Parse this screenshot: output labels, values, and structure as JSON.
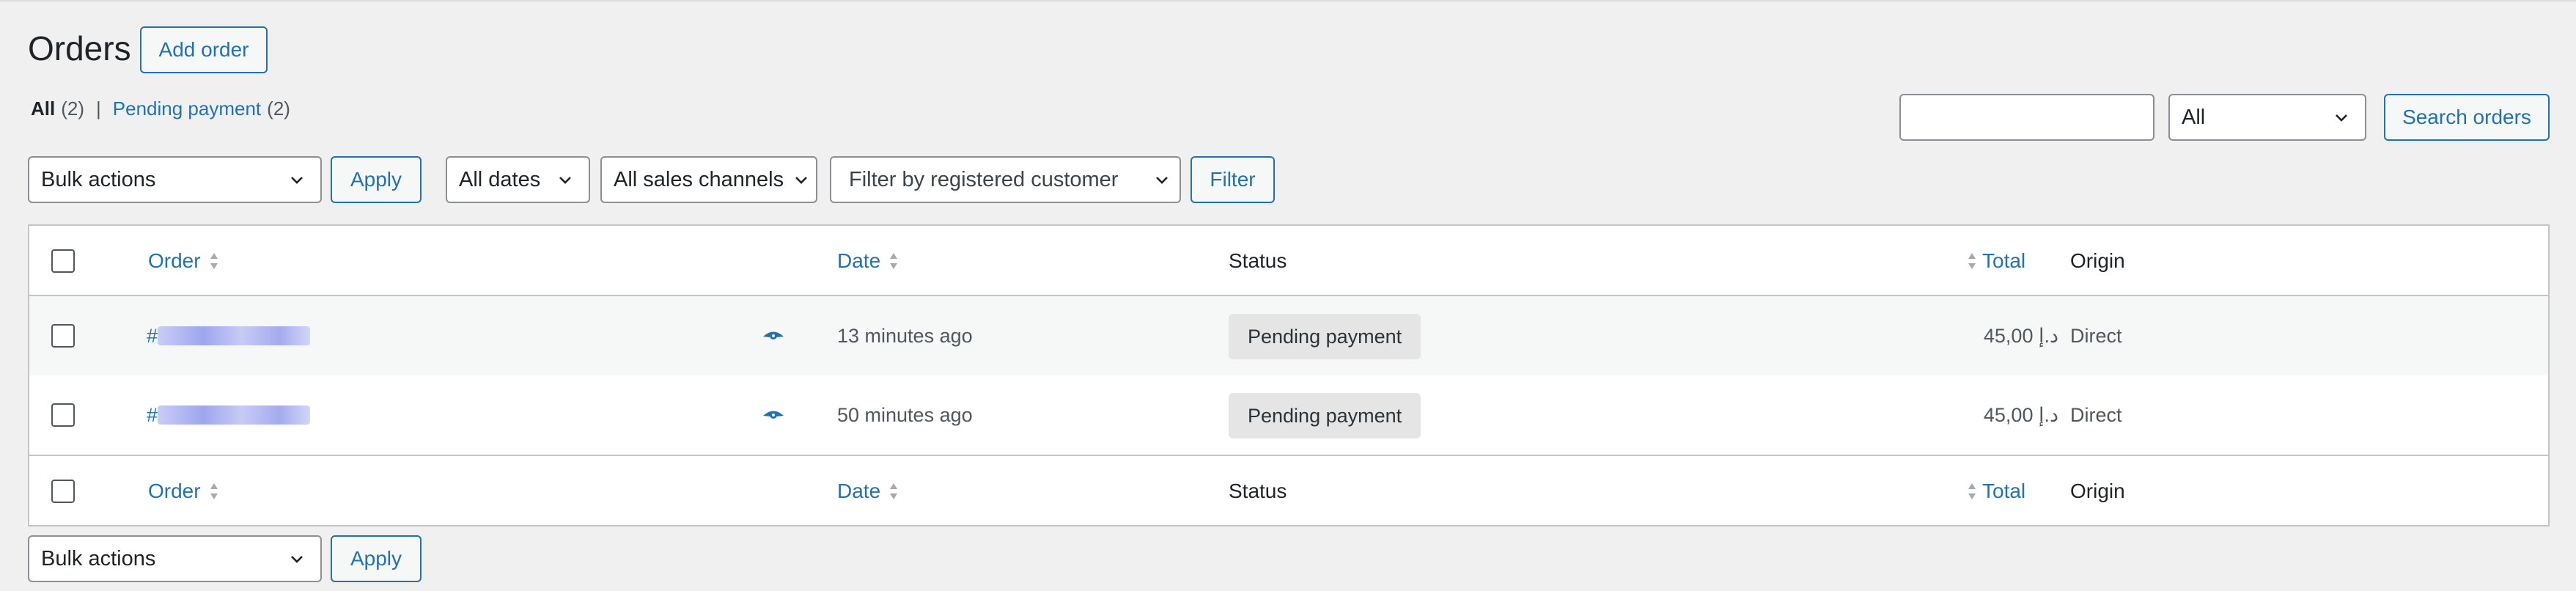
{
  "page": {
    "title": "Orders",
    "add_order_label": "Add order"
  },
  "views": {
    "all_label": "All",
    "all_count": "(2)",
    "separator": "|",
    "pending_label": "Pending payment",
    "pending_count": "(2)"
  },
  "search": {
    "input_value": "",
    "status_value": "All",
    "button_label": "Search orders"
  },
  "filters": {
    "bulk_actions": "Bulk actions",
    "apply_label": "Apply",
    "dates": "All dates",
    "channels": "All sales channels",
    "customer": "Filter by registered customer",
    "filter_label": "Filter"
  },
  "table": {
    "columns": {
      "order": "Order",
      "date": "Date",
      "status": "Status",
      "total": "Total",
      "origin": "Origin"
    },
    "rows": [
      {
        "order_prefix": "#",
        "date": "13 minutes ago",
        "status": "Pending payment",
        "total": "45,00 د.إ",
        "origin": "Direct"
      },
      {
        "order_prefix": "#",
        "date": "50 minutes ago",
        "status": "Pending payment",
        "total": "45,00 د.إ",
        "origin": "Direct"
      }
    ]
  },
  "bottom": {
    "bulk_actions": "Bulk actions",
    "apply_label": "Apply"
  },
  "colors": {
    "accent": "#2271b1",
    "background": "#f0f0f1",
    "badge": "#e5e5e5"
  },
  "icons": {
    "sort": "sort-arrows-icon",
    "preview": "eye-icon",
    "dropdown": "chevron-down-icon"
  }
}
